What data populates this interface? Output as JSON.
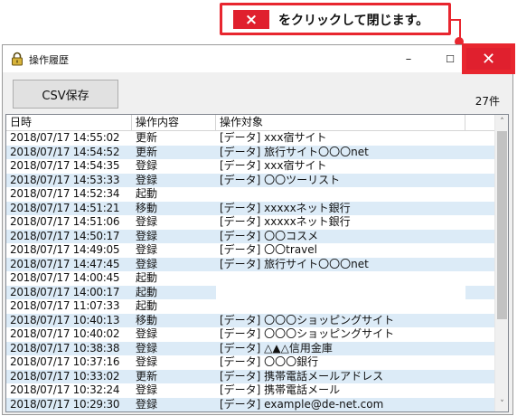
{
  "callout": {
    "x_label": "×",
    "text": "をクリックして閉じます。",
    "accent": "#e0202e"
  },
  "window": {
    "title": "操作履歴",
    "minimize_glyph": "–",
    "maximize_glyph": "☐",
    "close_glyph": "✕"
  },
  "toolbar": {
    "csv_button": "CSV保存",
    "count": "27件"
  },
  "list": {
    "headers": [
      "日時",
      "操作内容",
      "操作対象"
    ],
    "rows": [
      {
        "time": "2018/07/17 14:55:02",
        "op": "更新",
        "target": "[データ] xxx宿サイト"
      },
      {
        "time": "2018/07/17 14:54:52",
        "op": "更新",
        "target": "[データ] 旅行サイト〇〇〇net"
      },
      {
        "time": "2018/07/17 14:54:35",
        "op": "登録",
        "target": "[データ] xxx宿サイト"
      },
      {
        "time": "2018/07/17 14:53:33",
        "op": "登録",
        "target": "[データ] 〇〇ツーリスト"
      },
      {
        "time": "2018/07/17 14:52:34",
        "op": "起動",
        "target": ""
      },
      {
        "time": "2018/07/17 14:51:21",
        "op": "移動",
        "target": "[データ] xxxxxネット銀行"
      },
      {
        "time": "2018/07/17 14:51:06",
        "op": "登録",
        "target": "[データ] xxxxxネット銀行"
      },
      {
        "time": "2018/07/17 14:50:17",
        "op": "登録",
        "target": "[データ] 〇〇コスメ"
      },
      {
        "time": "2018/07/17 14:49:05",
        "op": "登録",
        "target": "[データ] 〇〇travel"
      },
      {
        "time": "2018/07/17 14:47:45",
        "op": "登録",
        "target": "[データ] 旅行サイト〇〇〇net"
      },
      {
        "time": "2018/07/17 14:00:45",
        "op": "起動",
        "target": ""
      },
      {
        "time": "2018/07/17 14:00:17",
        "op": "起動",
        "target": ""
      },
      {
        "time": "2018/07/17 11:07:33",
        "op": "起動",
        "target": ""
      },
      {
        "time": "2018/07/17 10:40:13",
        "op": "移動",
        "target": "[データ] 〇〇〇ショッピングサイト"
      },
      {
        "time": "2018/07/17 10:40:02",
        "op": "登録",
        "target": "[データ] 〇〇〇ショッピングサイト"
      },
      {
        "time": "2018/07/17 10:38:38",
        "op": "登録",
        "target": "[データ] △▲△信用金庫"
      },
      {
        "time": "2018/07/17 10:37:16",
        "op": "登録",
        "target": "[データ] 〇〇〇銀行"
      },
      {
        "time": "2018/07/17 10:33:02",
        "op": "更新",
        "target": "[データ] 携帯電話メールアドレス"
      },
      {
        "time": "2018/07/17 10:32:24",
        "op": "登録",
        "target": "[データ] 携帯電話メール"
      },
      {
        "time": "2018/07/17 10:29:30",
        "op": "登録",
        "target": "[データ] example@de-net.com"
      }
    ]
  },
  "scrollbar": {
    "up_glyph": "˄",
    "down_glyph": "˅"
  }
}
